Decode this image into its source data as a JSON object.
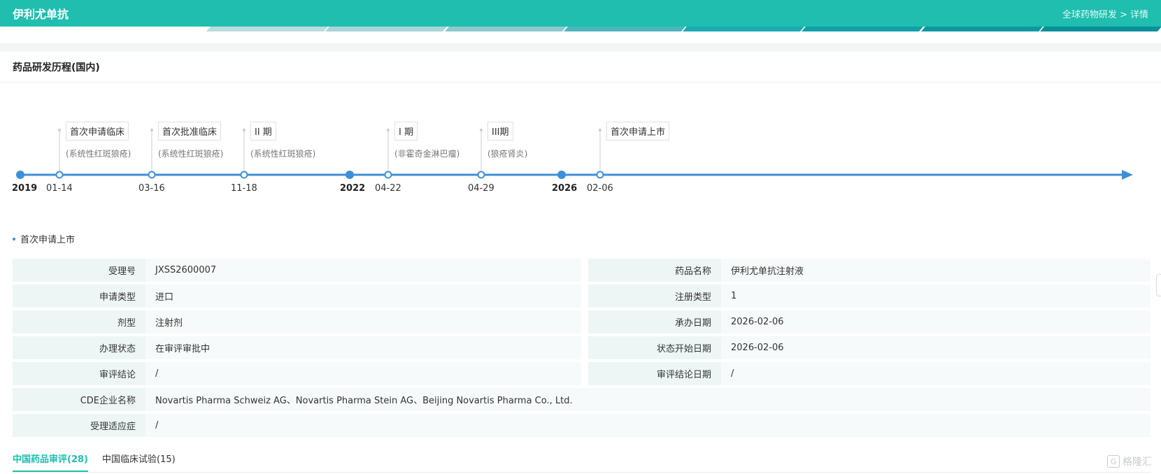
{
  "header": {
    "title": "伊利尤单抗",
    "breadcrumb": "全球药物研发 > 详情"
  },
  "colors": {
    "brand": "#1fbeaf",
    "timeline": "#3e8fd8"
  },
  "section": {
    "title": "药品研发历程(国内)"
  },
  "timeline": {
    "years": [
      "2019",
      "2022",
      "2026"
    ],
    "events": [
      {
        "date": "01-14",
        "label": "首次申请临床",
        "sub": "(系统性红斑狼疮)"
      },
      {
        "date": "03-16",
        "label": "首次批准临床",
        "sub": "(系统性红斑狼疮)"
      },
      {
        "date": "11-18",
        "label": "II 期",
        "sub": "(系统性红斑狼疮)"
      },
      {
        "date": "04-22",
        "label": "I 期",
        "sub": "(非霍奇金淋巴瘤)"
      },
      {
        "date": "04-29",
        "label": "III期",
        "sub": "(狼疮肾炎)"
      },
      {
        "date": "02-06",
        "label": "首次申请上市",
        "sub": ""
      }
    ]
  },
  "detail": {
    "title": "首次申请上市",
    "rows": [
      {
        "k1": "受理号",
        "v1": "JXSS2600007",
        "k2": "药品名称",
        "v2": "伊利尤单抗注射液"
      },
      {
        "k1": "申请类型",
        "v1": "进口",
        "k2": "注册类型",
        "v2": "1"
      },
      {
        "k1": "剂型",
        "v1": "注射剂",
        "k2": "承办日期",
        "v2": "2026-02-06"
      },
      {
        "k1": "办理状态",
        "v1": "在审评审批中",
        "k2": "状态开始日期",
        "v2": "2026-02-06"
      },
      {
        "k1": "审评结论",
        "v1": "/",
        "k2": "审评结论日期",
        "v2": "/"
      }
    ],
    "company_label": "CDE企业名称",
    "company_value": "Novartis Pharma Schweiz AG、Novartis Pharma Stein AG、Beijing Novartis Pharma Co., Ltd.",
    "indication_label": "受理适应症",
    "indication_value": "/"
  },
  "tabs": [
    {
      "label": "中国药品审评(28)"
    },
    {
      "label": "中国临床试验(15)"
    }
  ],
  "watermark": {
    "text": "格隆汇"
  }
}
